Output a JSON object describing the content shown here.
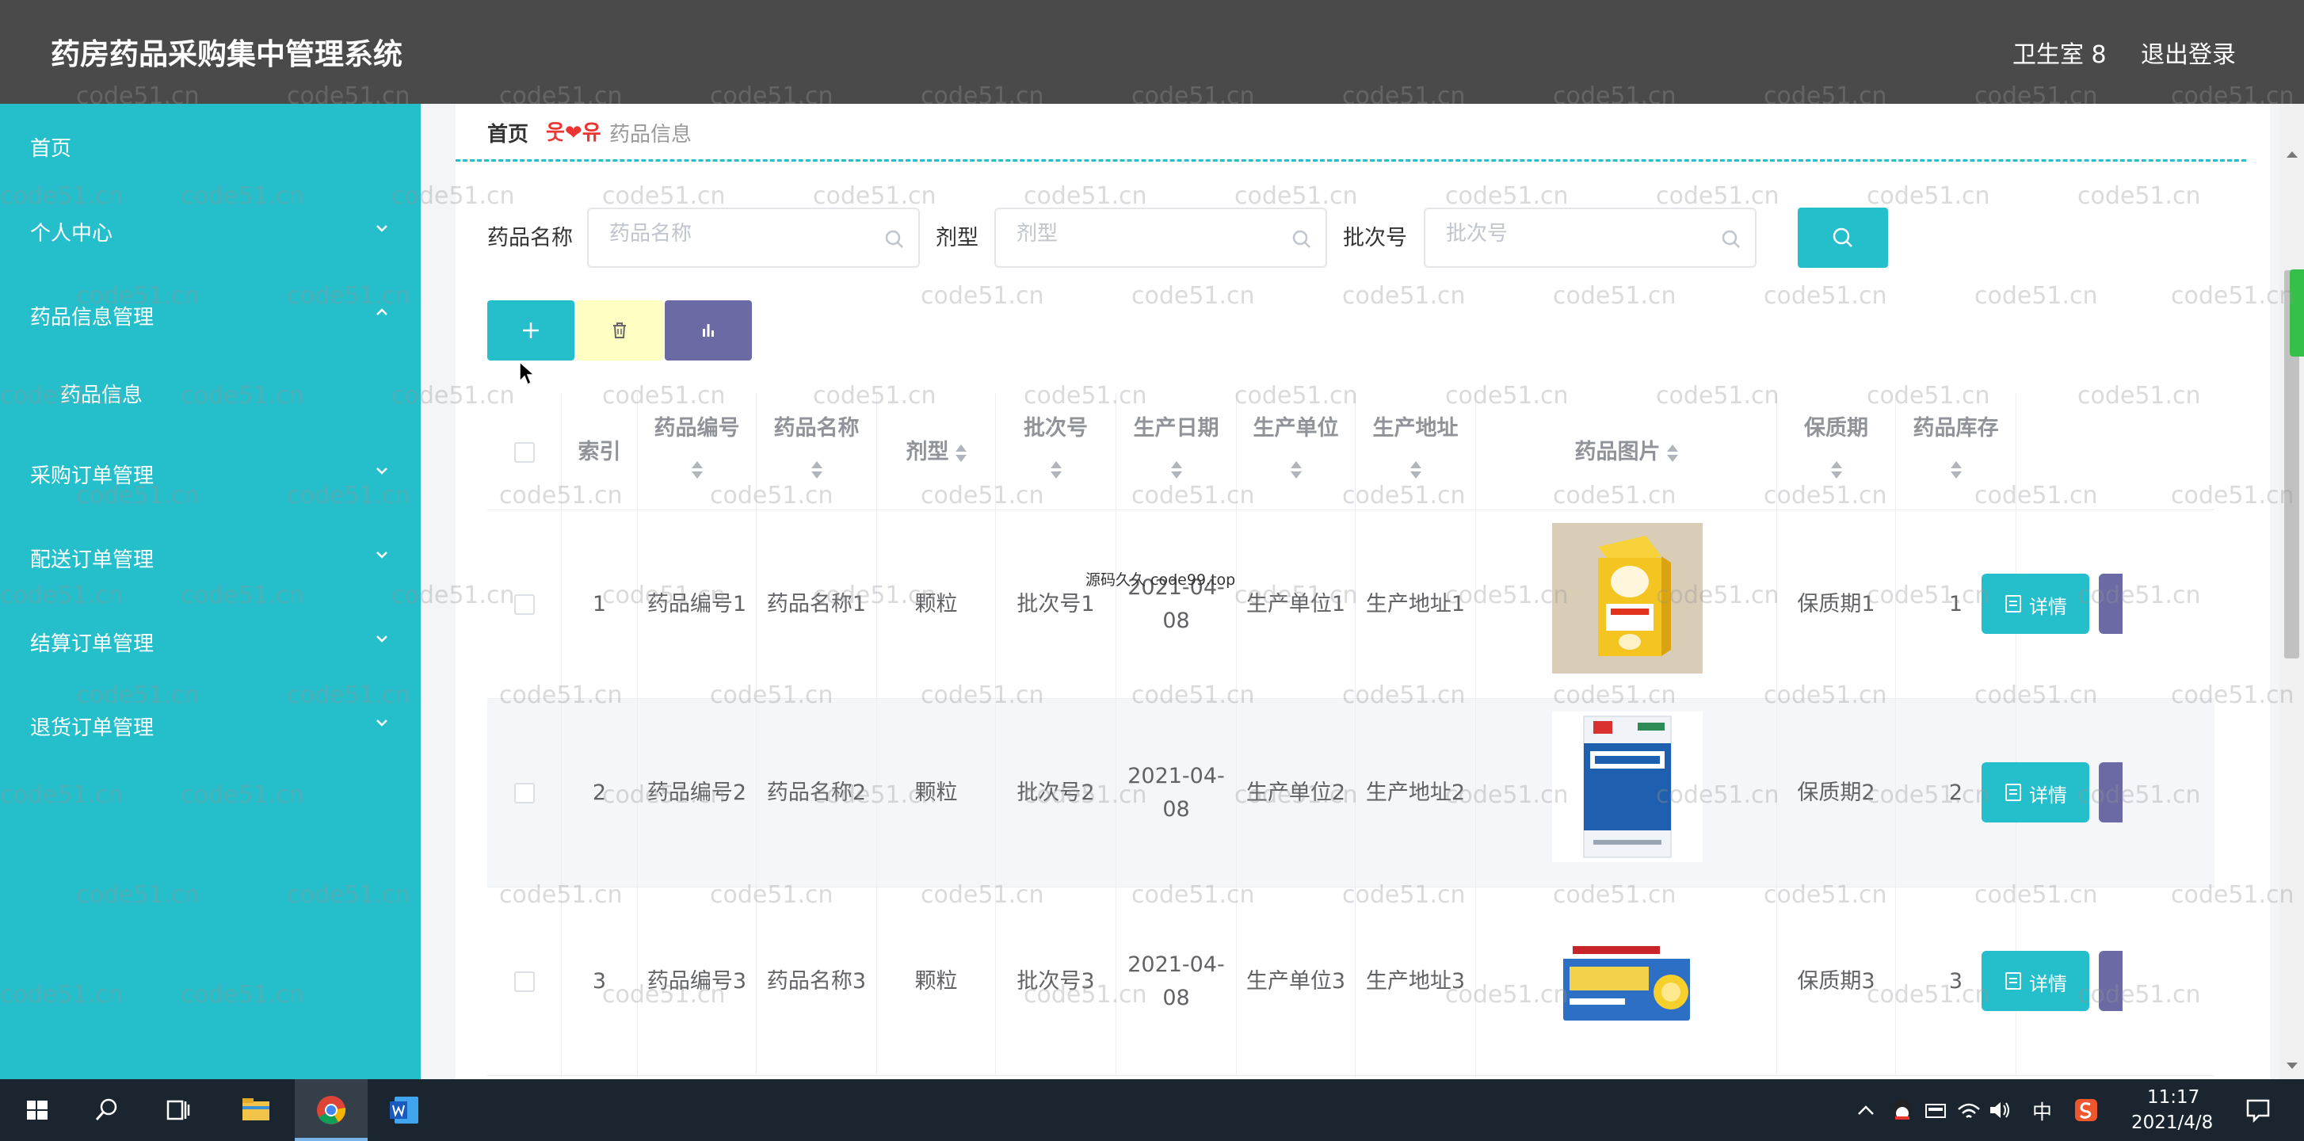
{
  "header": {
    "title": "药房药品采购集中管理系统",
    "user": "卫生室 8",
    "logout": "退出登录"
  },
  "sidebar": {
    "items": [
      {
        "label": "首页"
      },
      {
        "label": "个人中心"
      },
      {
        "label": "药品信息管理"
      },
      {
        "label": "药品信息"
      },
      {
        "label": "采购订单管理"
      },
      {
        "label": "配送订单管理"
      },
      {
        "label": "结算订单管理"
      },
      {
        "label": "退货订单管理"
      }
    ]
  },
  "breadcrumb": {
    "home": "首页",
    "separator": "웃❤유",
    "current": "药品信息"
  },
  "search": {
    "fields": [
      {
        "label": "药品名称",
        "placeholder": "药品名称"
      },
      {
        "label": "剂型",
        "placeholder": "剂型"
      },
      {
        "label": "批次号",
        "placeholder": "批次号"
      }
    ]
  },
  "table": {
    "headers": {
      "index": "索引",
      "code": "药品编号",
      "name": "药品名称",
      "form": "剂型",
      "batch": "批次号",
      "date": "生产日期",
      "maker": "生产单位",
      "address": "生产地址",
      "image": "药品图片",
      "shelf": "保质期",
      "stock": "药品库存"
    },
    "rows": [
      {
        "index": "1",
        "code": "药品编号1",
        "name": "药品名称1",
        "form": "颗粒",
        "batch": "批次号1",
        "date": "2021-04-08",
        "maker": "生产单位1",
        "address": "生产地址1",
        "shelf": "保质期1",
        "stock": "1",
        "detail": "详情"
      },
      {
        "index": "2",
        "code": "药品编号2",
        "name": "药品名称2",
        "form": "颗粒",
        "batch": "批次号2",
        "date": "2021-04-08",
        "maker": "生产单位2",
        "address": "生产地址2",
        "shelf": "保质期2",
        "stock": "2",
        "detail": "详情"
      },
      {
        "index": "3",
        "code": "药品编号3",
        "name": "药品名称3",
        "form": "颗粒",
        "batch": "批次号3",
        "date": "2021-04-08",
        "maker": "生产单位3",
        "address": "生产地址3",
        "shelf": "保质期3",
        "stock": "3",
        "detail": "详情"
      }
    ]
  },
  "overlay_text": "源码久久 code99.top",
  "watermark": "code51.cn",
  "taskbar": {
    "time": "11:17",
    "date": "2021/4/8",
    "ime": "中"
  },
  "colors": {
    "accent": "#25bfcc",
    "header_bg": "#4a4a4a",
    "stat_btn": "#6b6aa5",
    "delete_btn": "#ffffc4",
    "taskbar": "#1a2530"
  }
}
